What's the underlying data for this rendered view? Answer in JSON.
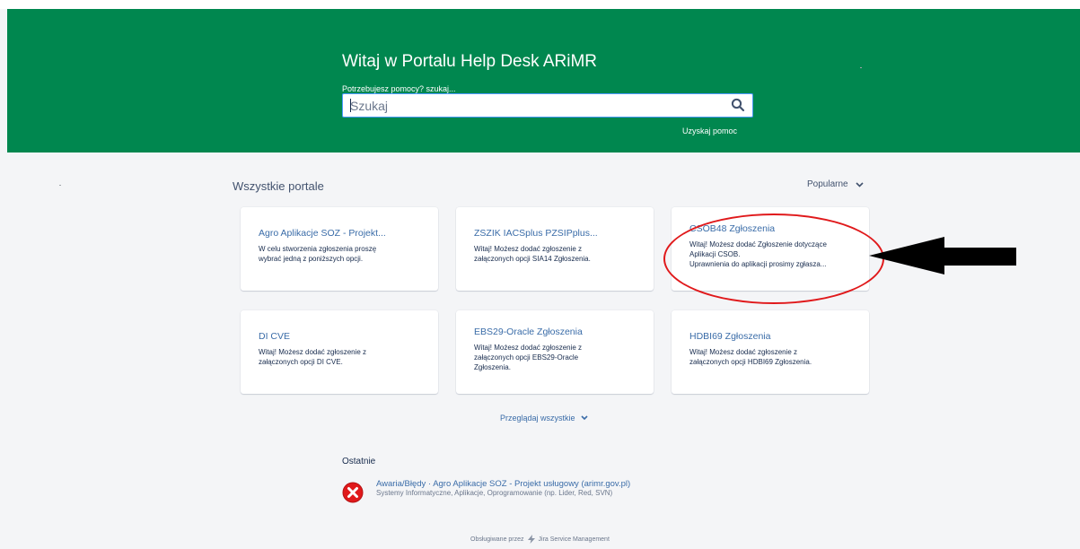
{
  "hero": {
    "title": "Witaj w Portalu Help Desk ARiMR",
    "help_label": "Potrzebujesz pomocy? szukaj...",
    "search_placeholder": "Szukaj",
    "search_icon": "search-icon",
    "get_help_link": "Uzyskaj pomoc",
    "background_color": "#00874f"
  },
  "portals": {
    "title": "Wszystkie portale",
    "sort_label": "Popularne",
    "sort_icon": "chevron-down-icon",
    "cards": [
      {
        "title": "Agro Aplikacje SOZ - Projekt...",
        "description": [
          "W celu stworzenia zgłoszenia proszę",
          "wybrać jedną z poniższych opcji."
        ]
      },
      {
        "title": "ZSZIK IACSplus PZSIPplus...",
        "description": [
          "Witaj! Możesz dodać zgłoszenie z",
          "załączonych opcji SIA14 Zgłoszenia."
        ]
      },
      {
        "title": "CSOB48 Zgłoszenia",
        "description": [
          "Witaj! Możesz dodać Zgłoszenie dotyczące",
          "Aplikacji CSOB.",
          "Uprawnienia do aplikacji prosimy zgłasza..."
        ]
      },
      {
        "title": "DI CVE",
        "description": [
          "Witaj! Możesz dodać zgłoszenie z",
          "załączonych opcji DI CVE."
        ]
      },
      {
        "title": "EBS29-Oracle Zgłoszenia",
        "description": [
          "Witaj! Możesz dodać zgłoszenie z",
          "załączonych opcji EBS29-Oracle",
          "Zgłoszenia."
        ]
      },
      {
        "title": "HDBI69 Zgłoszenia",
        "description": [
          "Witaj! Możesz dodać zgłoszenie z",
          "załączonych opcji HDBI69 Zgłoszenia."
        ]
      }
    ],
    "browse_all": "Przeglądaj wszystkie",
    "browse_icon": "chevron-down-icon"
  },
  "recent": {
    "title": "Ostatnie",
    "items": [
      {
        "title": "Awaria/Błędy · Agro Aplikacje SOZ - Projekt usługowy (arimr.gov.pl)",
        "subtitle": "Systemy Informatyczne, Aplikacje, Oprogramowanie (np. Lider, Red, SVN)",
        "icon": "error-icon",
        "icon_color": "#e0191b"
      }
    ]
  },
  "footer": {
    "prefix": "Obsługiwane przez",
    "brand": "Jira Service Management",
    "icon": "jira-bolt-icon"
  },
  "annotations": {
    "highlight_color": "#e0191b",
    "arrow_color": "#000000"
  }
}
